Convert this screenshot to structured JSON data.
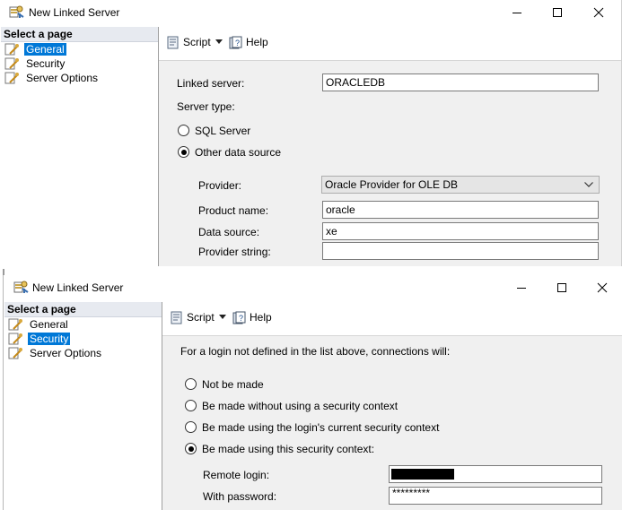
{
  "win1": {
    "title": "New Linked Server",
    "sidebar": {
      "header": "Select a page",
      "items": [
        {
          "label": "General"
        },
        {
          "label": "Security"
        },
        {
          "label": "Server Options"
        }
      ]
    },
    "toolbar": {
      "script_label": "Script",
      "help_label": "Help"
    },
    "form": {
      "linked_server_label": "Linked server:",
      "linked_server_value": "ORACLEDB",
      "server_type_label": "Server type:",
      "sql_server_label": "SQL Server",
      "other_source_label": "Other data source",
      "provider_label": "Provider:",
      "provider_value": "Oracle Provider for OLE DB",
      "product_name_label": "Product name:",
      "product_name_value": "oracle",
      "data_source_label": "Data source:",
      "data_source_value": "xe",
      "provider_string_label": "Provider string:",
      "provider_string_value": ""
    }
  },
  "win2": {
    "title": "New Linked Server",
    "sidebar": {
      "header": "Select a page",
      "items": [
        {
          "label": "General"
        },
        {
          "label": "Security"
        },
        {
          "label": "Server Options"
        }
      ]
    },
    "toolbar": {
      "script_label": "Script",
      "help_label": "Help"
    },
    "security": {
      "intro": "For a login not defined in the list above, connections will:",
      "options": [
        {
          "label": "Not be made"
        },
        {
          "label": "Be made without using a security context"
        },
        {
          "label": "Be made using the login's current security context"
        },
        {
          "label": "Be made using this security context:"
        }
      ],
      "remote_login_label": "Remote login:",
      "password_label": "With password:",
      "password_value": "*********"
    }
  },
  "icons": {
    "app": "linked-server-icon",
    "page": "page-wrench-icon",
    "script": "script-icon",
    "help": "help-icon"
  },
  "colors": {
    "selection": "#0078d7",
    "panel": "#f0f0f0",
    "header": "#e7eaf0"
  }
}
